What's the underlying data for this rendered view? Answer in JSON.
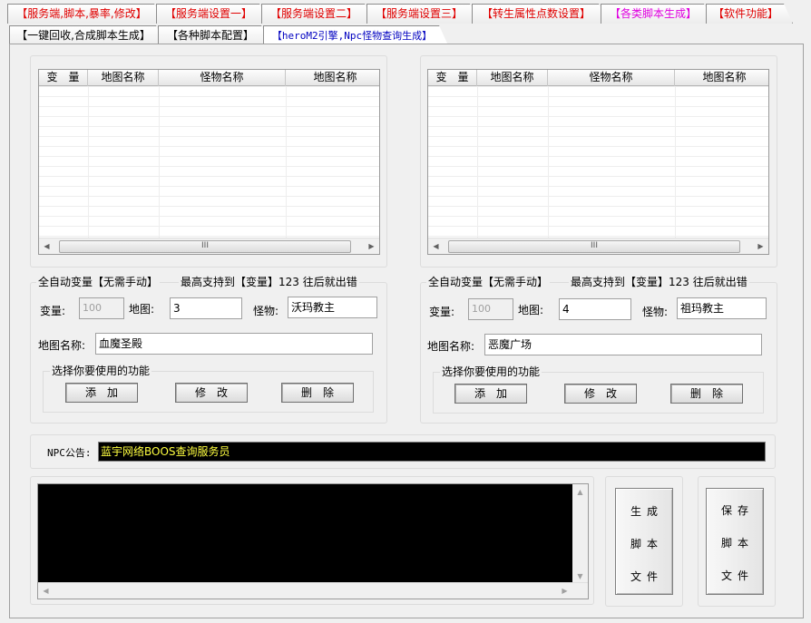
{
  "tabs_row1": [
    {
      "label": "【服务端,脚本,暴率,修改】",
      "color": "red"
    },
    {
      "label": "【服务端设置一】",
      "color": "red"
    },
    {
      "label": "【服务端设置二】",
      "color": "red"
    },
    {
      "label": "【服务端设置三】",
      "color": "red"
    },
    {
      "label": "【转生属性点数设置】",
      "color": "red"
    },
    {
      "label": "【各类脚本生成】",
      "color": "magenta"
    },
    {
      "label": "【软件功能】",
      "color": "red"
    }
  ],
  "tabs_row2": [
    {
      "label": "【一键回收,合成脚本生成】"
    },
    {
      "label": "【各种脚本配置】"
    },
    {
      "label": "【heroM2引擎,Npc怪物查询生成】"
    }
  ],
  "left": {
    "columns": [
      "变　量",
      "地图名称",
      "怪物名称",
      "地图名称"
    ],
    "auto_label": "全自动变量【无需手动】",
    "max_label": "最高支持到【变量】123 往后就出错",
    "var_label": "变量:",
    "var_value": "100",
    "map_label": "地图:",
    "map_value": "3",
    "monster_label": "怪物:",
    "monster_value": "沃玛教主",
    "mapname_label": "地图名称:",
    "mapname_value": "血魔圣殿",
    "func_legend": "选择你要使用的功能",
    "add": "添　加",
    "edit": "修　改",
    "del": "删　除"
  },
  "right": {
    "columns": [
      "变　量",
      "地图名称",
      "怪物名称",
      "地图名称"
    ],
    "auto_label": "全自动变量【无需手动】",
    "max_label": "最高支持到【变量】123 往后就出错",
    "var_label": "变量:",
    "var_value": "100",
    "map_label": "地图:",
    "map_value": "4",
    "monster_label": "怪物:",
    "monster_value": "祖玛教主",
    "mapname_label": "地图名称:",
    "mapname_value": "恶魔广场",
    "func_legend": "选择你要使用的功能",
    "add": "添　加",
    "edit": "修　改",
    "del": "删　除"
  },
  "npc": {
    "label": "NPC公告:",
    "value": "蓝宇网络BOOS查询服务员"
  },
  "buttons": {
    "generate": [
      "生成",
      "脚本",
      "文件"
    ],
    "save": [
      "保存",
      "脚本",
      "文件"
    ]
  },
  "scroll_thumb_glyph": "III",
  "colors": {
    "tab_red": "#e00000",
    "tab_magenta": "#e000e0",
    "tab_blue": "#0000c0",
    "console_bg": "#000000",
    "npc_text": "#ffff40"
  }
}
